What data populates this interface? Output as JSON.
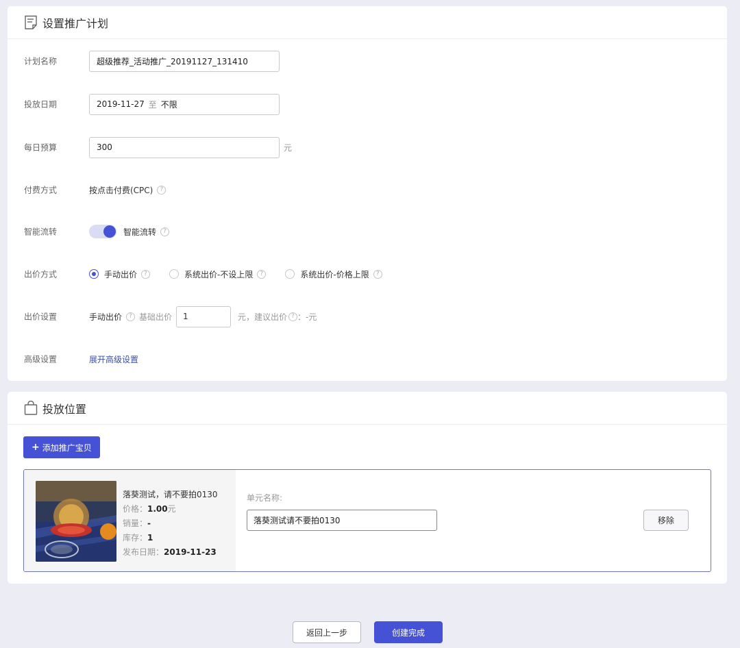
{
  "plan_section": {
    "title": "设置推广计划",
    "title_icon": "document-icon",
    "fields": {
      "plan_name": {
        "label": "计划名称",
        "value": "超级推荐_活动推广_20191127_131410"
      },
      "schedule": {
        "label": "投放日期",
        "start": "2019-11-27",
        "separator": "至",
        "end": "不限"
      },
      "daily_budget": {
        "label": "每日预算",
        "value": "300",
        "unit": "元"
      },
      "payment": {
        "label": "付费方式",
        "value": "按点击付费(CPC)",
        "help_icon": "question-circle-icon"
      },
      "smart_flow": {
        "label": "智能流转",
        "toggle_on": true,
        "toggle_text": "智能流转",
        "accent": "#4652d6"
      },
      "bid_mode": {
        "label": "出价方式",
        "options": [
          {
            "text": "手动出价",
            "selected": true
          },
          {
            "text": "系统出价-不设上限",
            "selected": false
          },
          {
            "text": "系统出价-价格上限",
            "selected": false
          }
        ]
      },
      "bid_settings": {
        "label": "出价设置",
        "manual_text": "手动出价",
        "base_bid_label": "基础出价",
        "base_bid_value": "1",
        "suffix": "元，建议出价",
        "suggest_value": "：-元"
      },
      "advanced": {
        "label": "高级设置",
        "link": "展开高级设置"
      }
    }
  },
  "placement_section": {
    "title": "投放位置",
    "title_icon": "shopping-bag-icon",
    "add_button": {
      "plus": "+",
      "label": "添加推广宝贝"
    },
    "item": {
      "name": "落葵测试，请不要拍0130",
      "price_label": "价格：",
      "price_value": "1.00",
      "price_unit": "元",
      "sales_label": "销量：",
      "sales_value": "-",
      "stock_label": "库存：",
      "stock_value": "1",
      "date_label": "发布日期：",
      "date_value": "2019-11-23",
      "unit_name_label": "单元名称:",
      "unit_name_value": "落葵测试请不要拍0130",
      "remove_label": "移除"
    }
  },
  "footer": {
    "back_label": "返回上一步",
    "create_label": "创建完成"
  }
}
